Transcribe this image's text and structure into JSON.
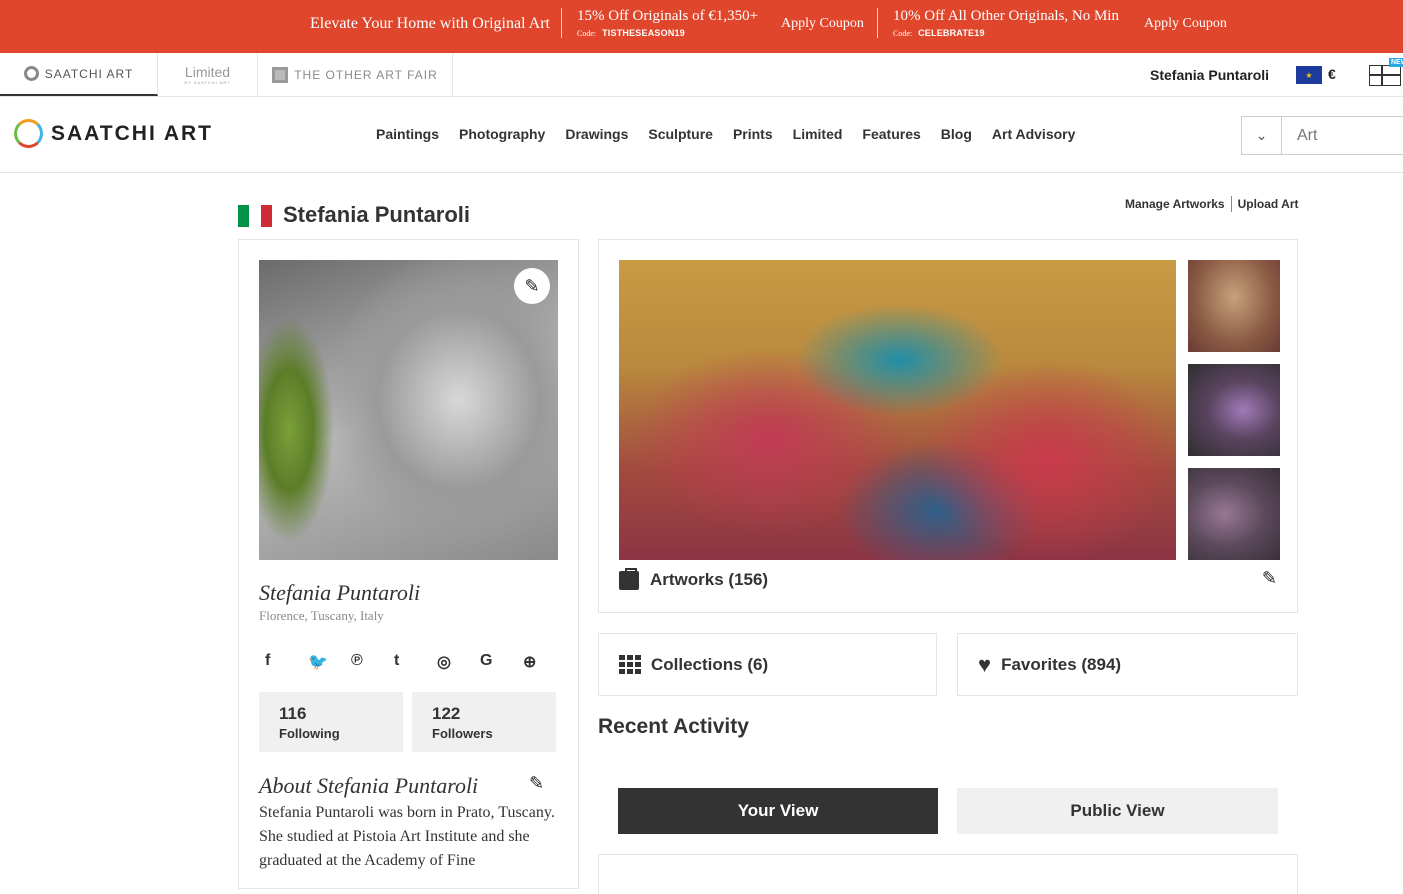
{
  "promo": {
    "headline": "Elevate Your Home with Original Art",
    "offers": [
      {
        "text": "15% Off Originals of €1,350+",
        "code_label": "Code:",
        "code": "TISTHESEASON19",
        "apply": "Apply Coupon"
      },
      {
        "text": "10% Off All Other Originals, No Min",
        "code_label": "Code:",
        "code": "CELEBRATE19",
        "apply": "Apply Coupon"
      }
    ]
  },
  "sitebar": {
    "tabs": [
      "SAATCHI ART",
      "Limited",
      "THE OTHER ART FAIR"
    ],
    "limited_sub": "BY SAATCHI ART",
    "user": "Stefania Puntaroli",
    "currency": "€",
    "new_badge": "NEW"
  },
  "nav": {
    "logo": "SAATCHI ART",
    "links": [
      "Paintings",
      "Photography",
      "Drawings",
      "Sculpture",
      "Prints",
      "Limited",
      "Features",
      "Blog",
      "Art Advisory"
    ],
    "search_placeholder": "Art"
  },
  "profile": {
    "name": "Stefania Puntaroli",
    "manage": "Manage Artworks",
    "upload": "Upload Art",
    "card_name": "Stefania Puntaroli",
    "location": "Florence, Tuscany, Italy",
    "following_count": "116",
    "following_label": "Following",
    "followers_count": "122",
    "followers_label": "Followers",
    "about_title": "About Stefania Puntaroli",
    "about_text": "Stefania Puntaroli was born in Prato, Tuscany. She studied at Pistoia Art Institute and she graduated at the Academy of Fine"
  },
  "artworks": {
    "label": "Artworks (156)"
  },
  "collections": {
    "label": "Collections (6)"
  },
  "favorites": {
    "label": "Favorites (894)"
  },
  "recent": {
    "title": "Recent Activity",
    "your_view": "Your View",
    "public_view": "Public View"
  },
  "colors": {
    "promo": "#e0462c",
    "italy_green": "#009246",
    "italy_red": "#ce2b37"
  }
}
